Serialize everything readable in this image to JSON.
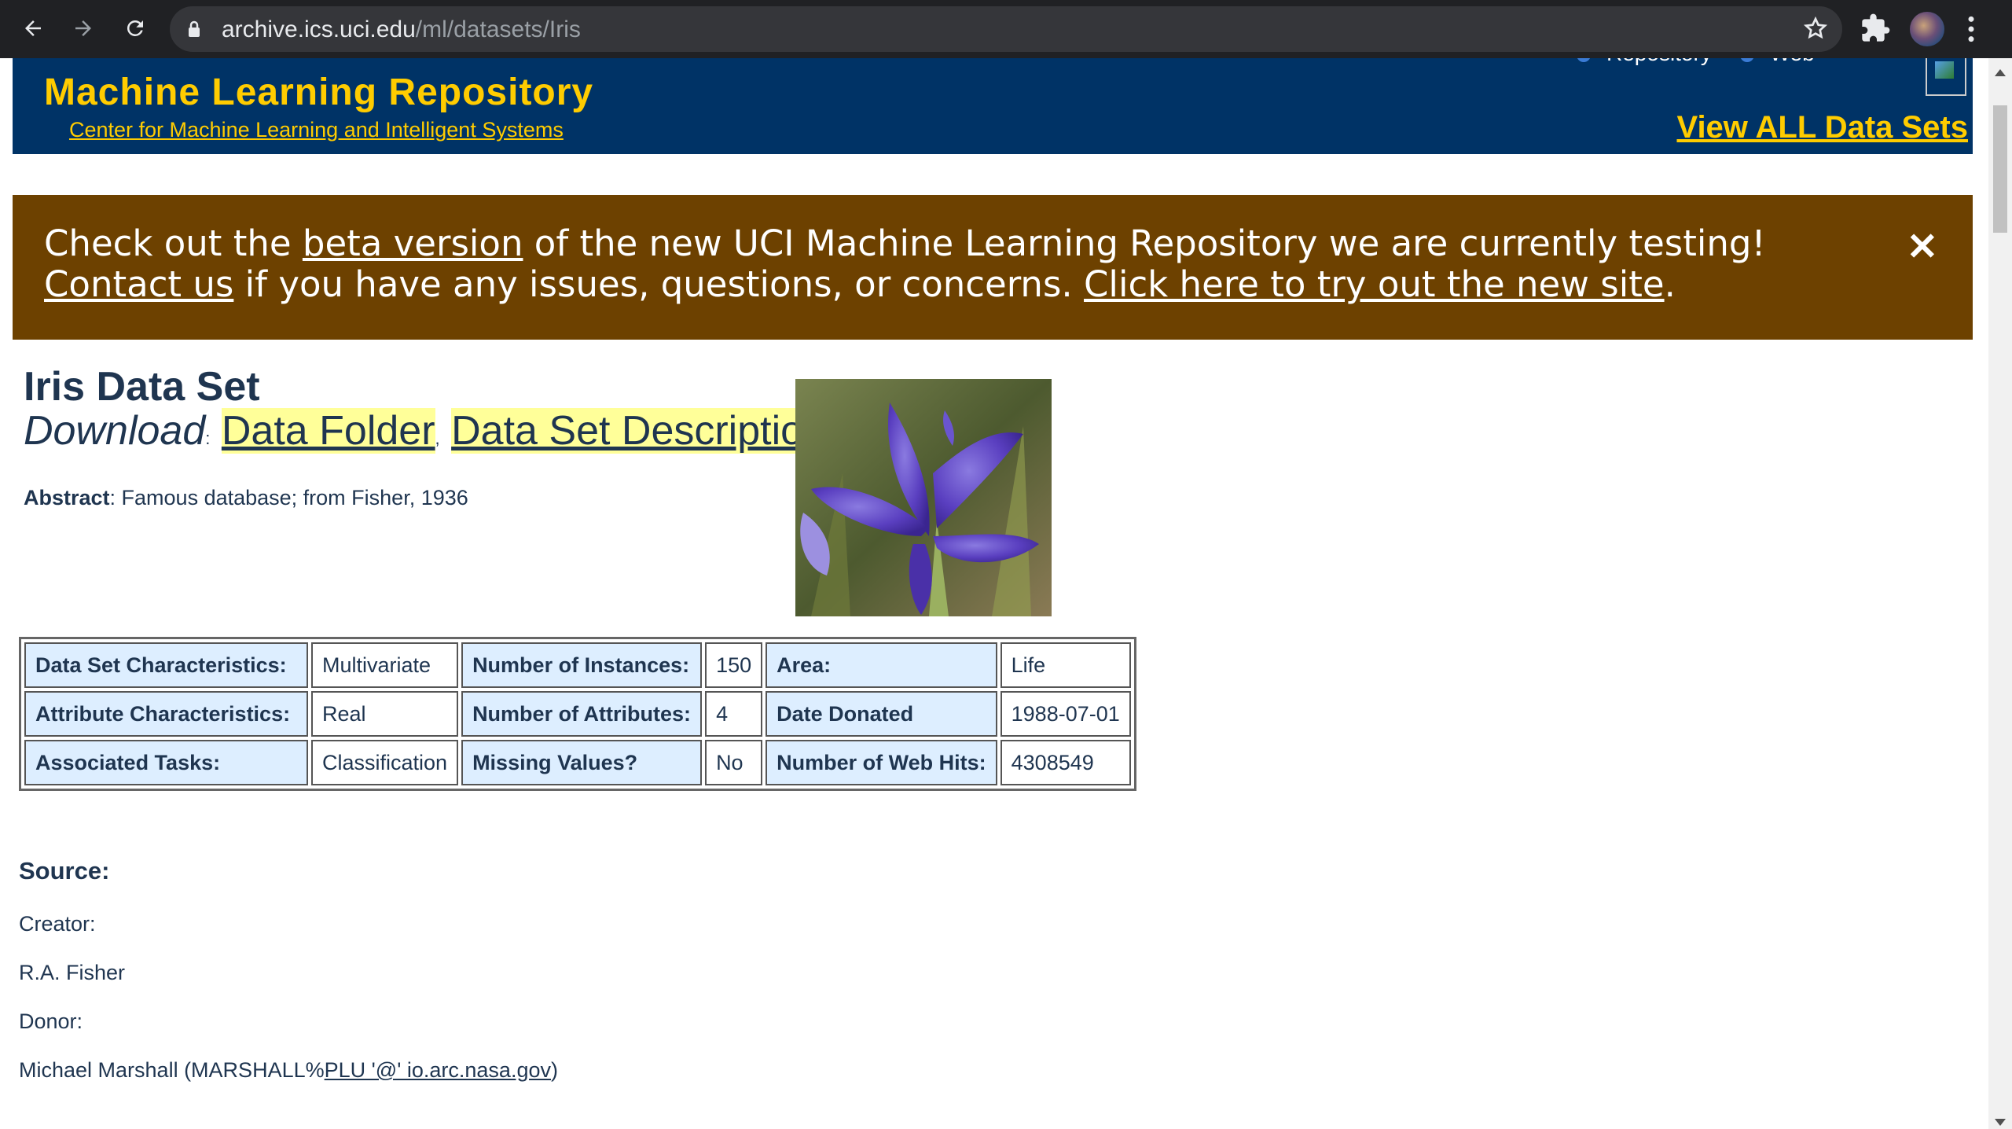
{
  "browser": {
    "url_host": "archive.ics.uci.edu",
    "url_path": "/ml/datasets/Iris"
  },
  "header": {
    "title": "Machine Learning Repository",
    "subtitle": "Center for Machine Learning and Intelligent Systems",
    "radio_repository": "Repository",
    "radio_web": "Web",
    "view_all": "View ALL Data Sets"
  },
  "banner": {
    "text_1": "Check out the ",
    "link_beta": "beta version",
    "text_2": " of the new UCI Machine Learning Repository we are currently testing! ",
    "link_contact": "Contact us",
    "text_3": " if you have any issues, questions, or concerns. ",
    "link_try": "Click here to try out the new site",
    "text_4": ".",
    "close": "✕"
  },
  "dataset": {
    "title": "Iris Data Set",
    "download_label": "Download",
    "download_sep": ":",
    "link_folder": "Data Folder",
    "comma": ",",
    "link_description": "Data Set Description",
    "abstract_label": "Abstract",
    "abstract_text": ": Famous database; from Fisher, 1936"
  },
  "table": {
    "rows": [
      [
        {
          "k": "Data Set Characteristics:",
          "v": "Multivariate"
        },
        {
          "k": "Number of Instances:",
          "v": "150"
        },
        {
          "k": "Area:",
          "v": "Life"
        }
      ],
      [
        {
          "k": "Attribute Characteristics:",
          "v": "Real"
        },
        {
          "k": "Number of Attributes:",
          "v": "4"
        },
        {
          "k": "Date Donated",
          "v": "1988-07-01"
        }
      ],
      [
        {
          "k": "Associated Tasks:",
          "v": "Classification"
        },
        {
          "k": "Missing Values?",
          "v": "No"
        },
        {
          "k": "Number of Web Hits:",
          "v": "4308549"
        }
      ]
    ]
  },
  "source": {
    "heading": "Source:",
    "creator_label": "Creator:",
    "creator_name": "R.A. Fisher",
    "donor_label": "Donor:",
    "donor_prefix": "Michael Marshall (MARSHALL%",
    "donor_link": "PLU '@' io.arc.nasa.gov",
    "donor_suffix": ")"
  },
  "colors": {
    "header_bg": "#003366",
    "header_accent": "#ffcc00",
    "banner_bg": "#6d4100",
    "key_cell_bg": "#ddeeff",
    "link_highlight": "#ffff99"
  }
}
